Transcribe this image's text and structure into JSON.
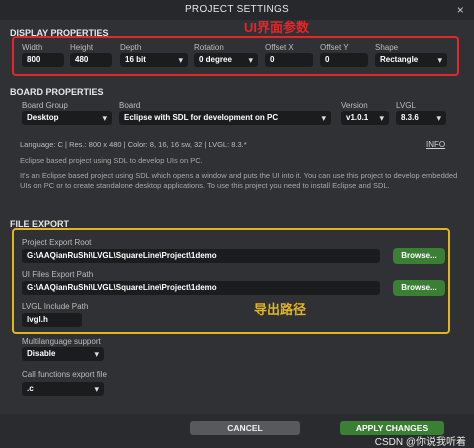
{
  "window": {
    "title": "PROJECT SETTINGS",
    "close_label": "×"
  },
  "display": {
    "section_title": "DISPLAY PROPERTIES",
    "annotation": "UI界面参数",
    "width_label": "Width",
    "width_value": "800",
    "height_label": "Height",
    "height_value": "480",
    "depth_label": "Depth",
    "depth_value": "16 bit",
    "rotation_label": "Rotation",
    "rotation_value": "0 degree",
    "offsetx_label": "Offset X",
    "offsetx_value": "0",
    "offsety_label": "Offset Y",
    "offsety_value": "0",
    "shape_label": "Shape",
    "shape_value": "Rectangle"
  },
  "board": {
    "section_title": "BOARD PROPERTIES",
    "group_label": "Board Group",
    "group_value": "Desktop",
    "board_label": "Board",
    "board_value": "Eclipse with SDL for development on PC",
    "version_label": "Version",
    "version_value": "v1.0.1",
    "lvgl_label": "LVGL",
    "lvgl_value": "8.3.6",
    "summary": "Language: C | Res.: 800 x 480 | Color: 8, 16, 16 sw, 32 | LVGL: 8.3.*",
    "info_link": "INFO",
    "desc1": "Eclipse based project using SDL to develop UIs on PC.",
    "desc2": "It's an Eclipse based project using SDL which opens a window and puts the UI into it. You can use this project to develop embedded UIs on PC or to create standalone desktop applications. To use this project you need to install Eclipse and SDL."
  },
  "file_export": {
    "section_title": "FILE EXPORT",
    "annotation": "导出路径",
    "project_root_label": "Project Export Root",
    "project_root_value": "G:\\AAQianRuShi\\LVGL\\SquareLine\\Project\\1demo",
    "ui_files_label": "UI Files Export Path",
    "ui_files_value": "G:\\AAQianRuShi\\LVGL\\SquareLine\\Project\\1demo",
    "browse_label": "Browse...",
    "lvgl_include_label": "LVGL Include Path",
    "lvgl_include_value": "lvgl.h"
  },
  "misc": {
    "multilang_label": "Multilanguage support",
    "multilang_value": "Disable",
    "callfn_label": "Call functions export file",
    "callfn_value": ".c"
  },
  "footer": {
    "cancel": "CANCEL",
    "apply": "APPLY CHANGES",
    "watermark": "CSDN @你说我听着"
  },
  "colors": {
    "accent_green": "#3a7f34",
    "annotation_red": "#e3262a",
    "annotation_yellow": "#e2b621"
  }
}
